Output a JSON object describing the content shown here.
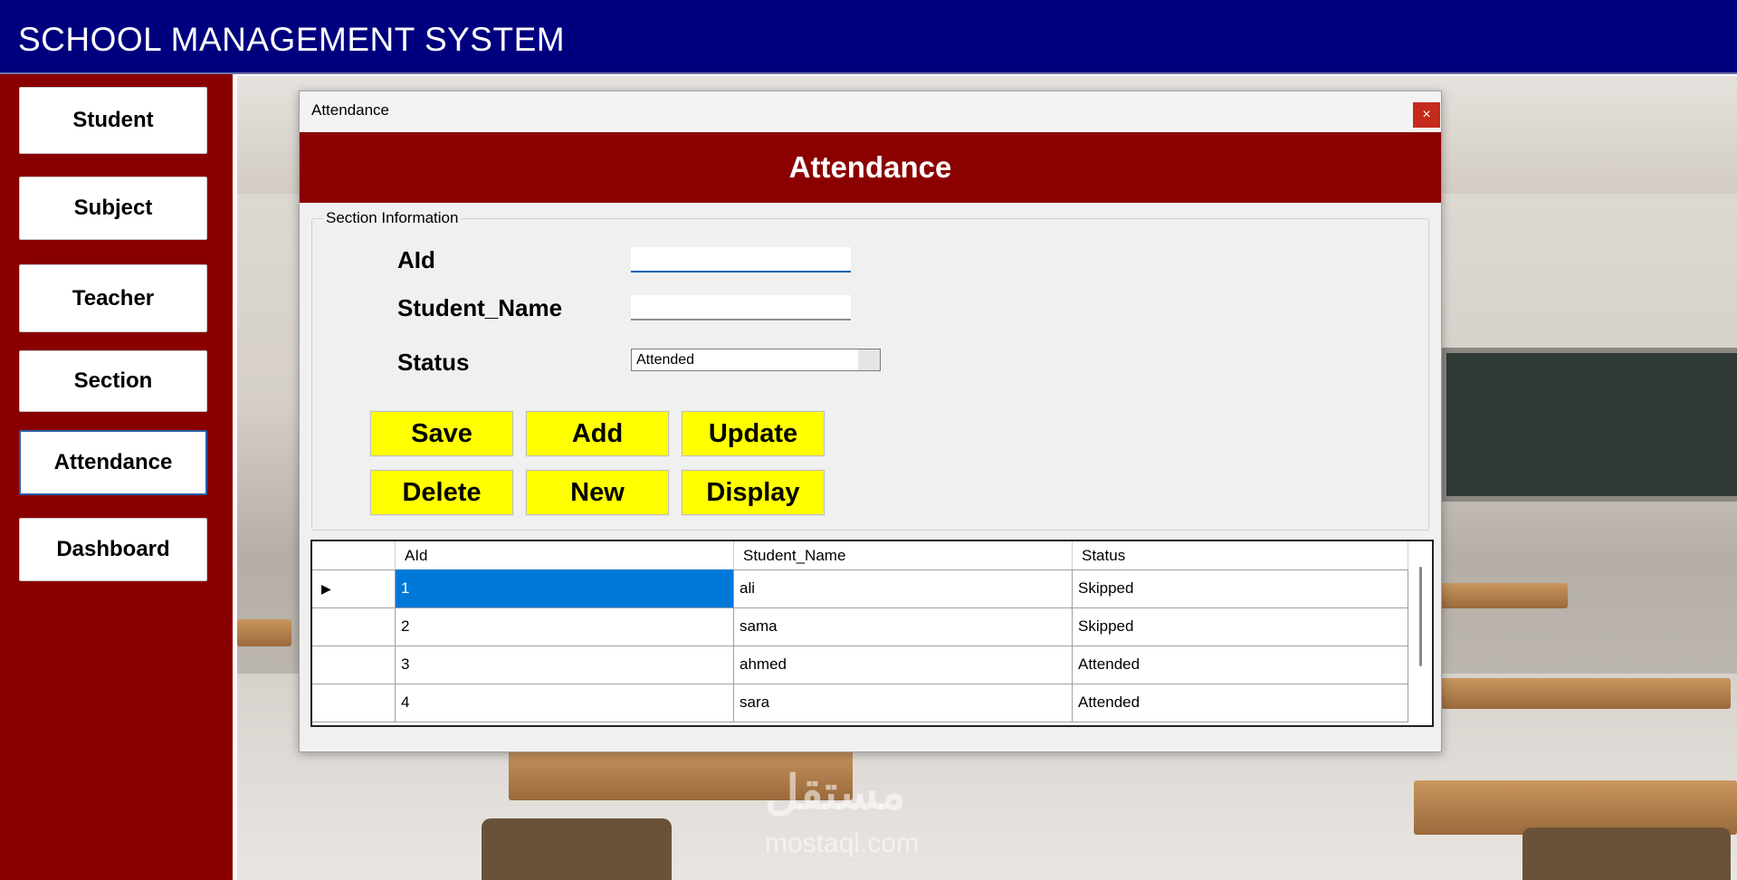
{
  "app": {
    "title": "SCHOOL MANAGEMENT SYSTEM"
  },
  "sidebar": {
    "items": [
      {
        "label": "Student"
      },
      {
        "label": "Subject"
      },
      {
        "label": "Teacher"
      },
      {
        "label": "Section"
      },
      {
        "label": "Attendance",
        "active": true
      },
      {
        "label": "Dashboard"
      }
    ]
  },
  "dialog": {
    "window_title": "Attendance",
    "close_glyph": "×",
    "heading": "Attendance",
    "group_title": "Section Information",
    "fields": {
      "aid_label": "AId",
      "aid_value": "",
      "student_name_label": "Student_Name",
      "student_name_value": "",
      "status_label": "Status",
      "status_value": "Attended"
    },
    "buttons": {
      "save": "Save",
      "add": "Add",
      "update": "Update",
      "delete": "Delete",
      "new": "New",
      "display": "Display"
    },
    "grid": {
      "columns": [
        "AId",
        "Student_Name",
        "Status"
      ],
      "rows": [
        {
          "aid": "1",
          "student_name": "ali",
          "status": "Skipped"
        },
        {
          "aid": "2",
          "student_name": "sama",
          "status": "Skipped"
        },
        {
          "aid": "3",
          "student_name": "ahmed",
          "status": "Attended"
        },
        {
          "aid": "4",
          "student_name": "sara",
          "status": "Attended"
        }
      ],
      "current_row_marker": "▶"
    }
  },
  "watermark": {
    "text": "مستقل",
    "sub": "mostaql.com"
  },
  "colors": {
    "header": "#00007f",
    "sidebar": "#890000",
    "banner": "#8b0000",
    "action_button": "#ffff00",
    "selection": "#0078d7"
  }
}
